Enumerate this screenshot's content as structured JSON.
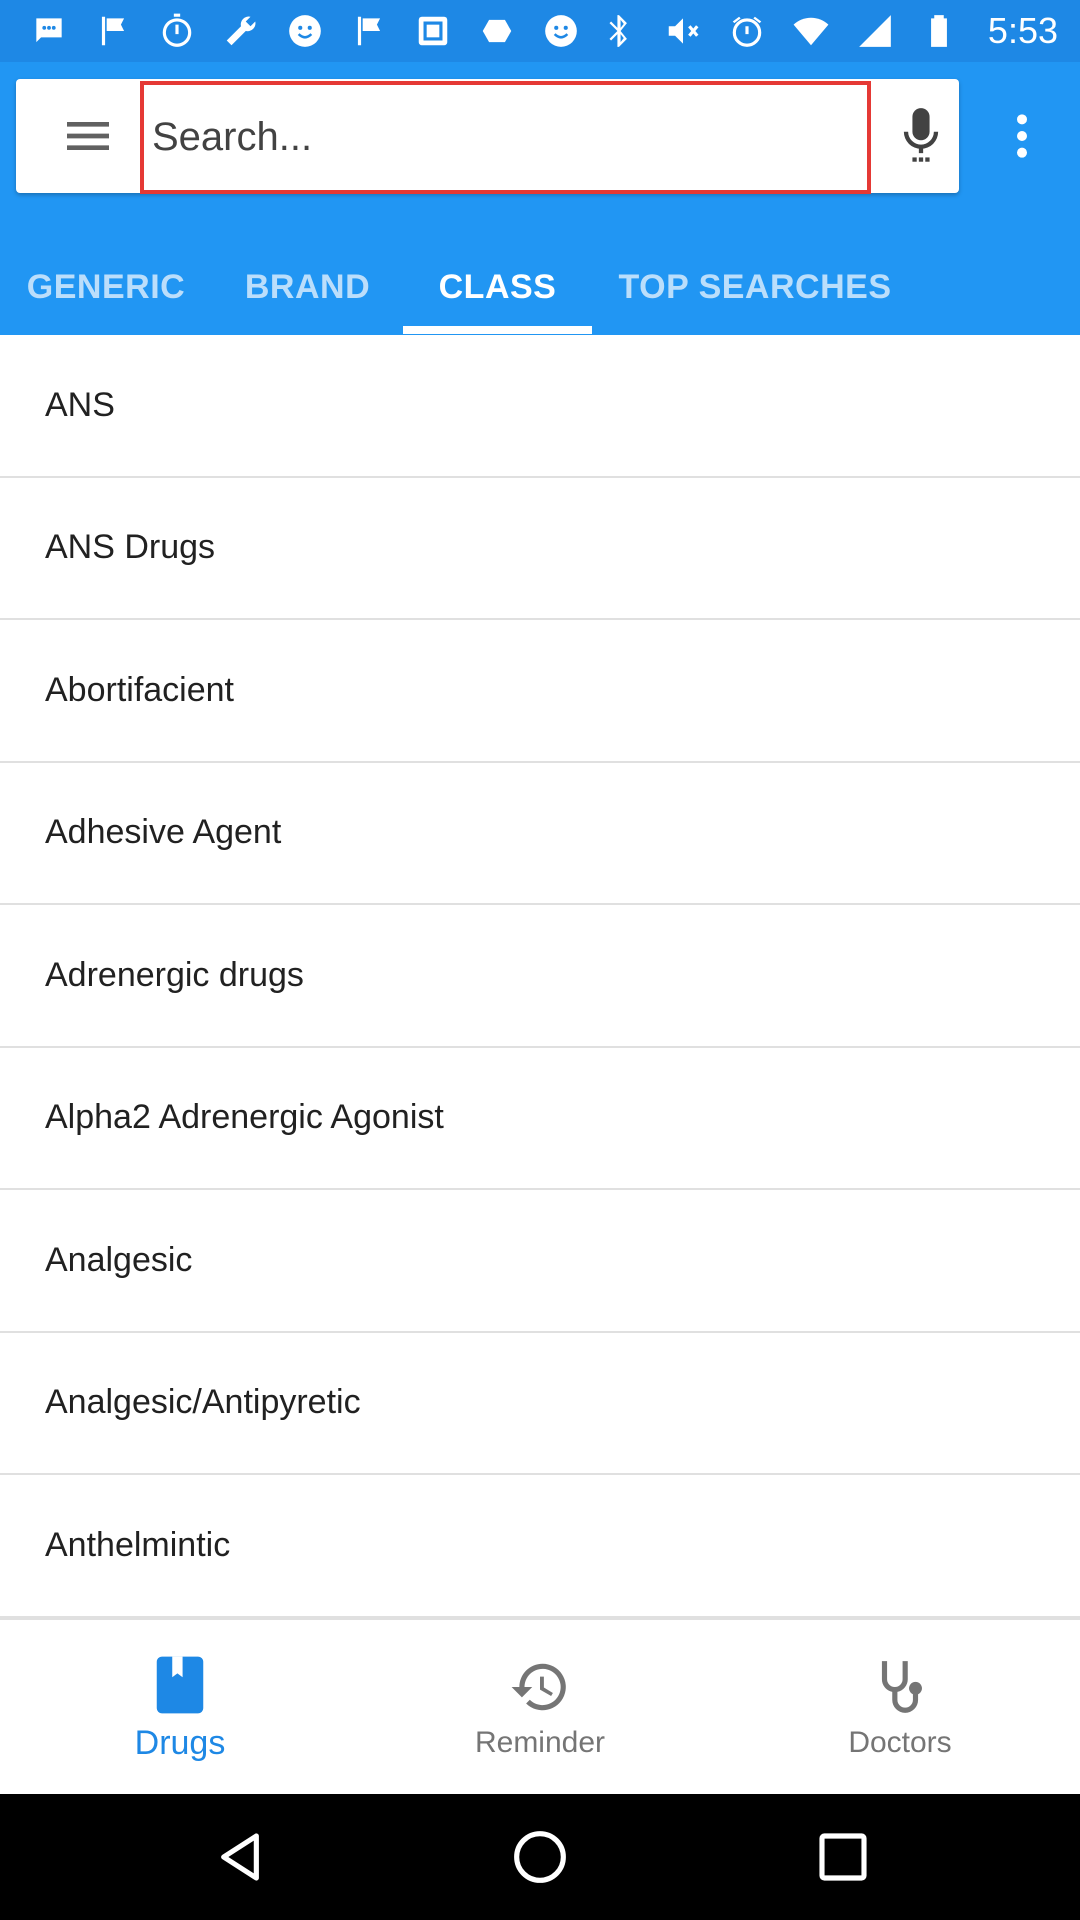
{
  "status_bar": {
    "time": "5:53",
    "left_icons": [
      "chat-icon",
      "flag-icon",
      "timer-icon",
      "wrench-icon",
      "smiley-icon",
      "flag-icon",
      "qr-icon",
      "vpn-icon",
      "smiley-icon"
    ],
    "right_icons": [
      "bluetooth-icon",
      "mute-icon",
      "alarm-icon",
      "wifi-icon",
      "signal-icon",
      "battery-icon"
    ]
  },
  "search": {
    "placeholder": "Search..."
  },
  "tabs": [
    {
      "label": "GENERIC"
    },
    {
      "label": "BRAND"
    },
    {
      "label": "CLASS"
    },
    {
      "label": "TOP SEARCHES"
    }
  ],
  "active_tab": "CLASS",
  "list": [
    "ANS",
    "ANS Drugs",
    "Abortifacient",
    "Adhesive Agent",
    "Adrenergic drugs",
    "Alpha2 Adrenergic Agonist",
    "Analgesic",
    "Analgesic/Antipyretic",
    "Anthelmintic"
  ],
  "bottom_nav": [
    {
      "label": "Drugs",
      "icon": "book-icon"
    },
    {
      "label": "Reminder",
      "icon": "history-icon"
    },
    {
      "label": "Doctors",
      "icon": "stethoscope-icon"
    }
  ],
  "active_nav": "Drugs",
  "colors": {
    "primary": "#2196f3",
    "status_bar": "#1e88e5",
    "search_highlight": "#e53935",
    "active_nav": "#1e88e5"
  }
}
